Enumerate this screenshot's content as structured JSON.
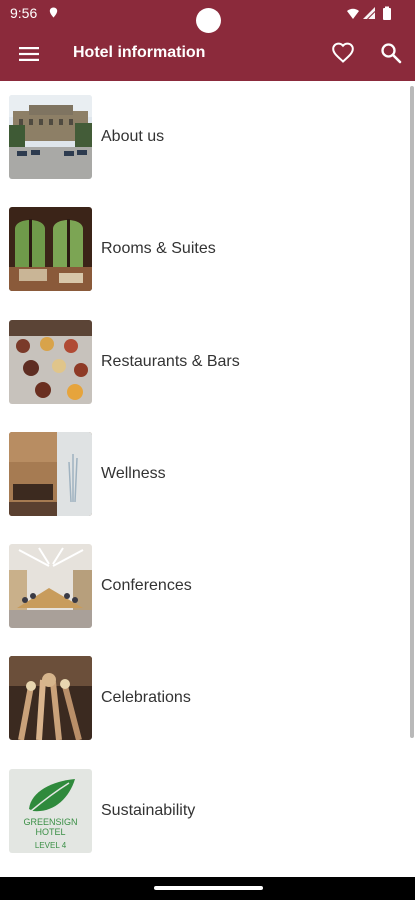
{
  "status_bar": {
    "time": "9:56"
  },
  "app_bar": {
    "title": "Hotel information",
    "colors": {
      "primary": "#8b2a3b",
      "on_primary": "#ffffff"
    },
    "icons": [
      "menu-icon",
      "heart-icon",
      "search-icon"
    ]
  },
  "menu": {
    "items": [
      {
        "label": "About us",
        "image": "hotel-exterior"
      },
      {
        "label": "Rooms & Suites",
        "image": "room-windows"
      },
      {
        "label": "Restaurants & Bars",
        "image": "breakfast-jars"
      },
      {
        "label": "Wellness",
        "image": "spa-lounge"
      },
      {
        "label": "Conferences",
        "image": "conference-room"
      },
      {
        "label": "Celebrations",
        "image": "champagne-toast"
      },
      {
        "label": "Sustainability",
        "image": "greensign-logo"
      }
    ]
  },
  "greensign_logo": {
    "line1": "GREENSIGN",
    "line2": "HOTEL",
    "line3": "LEVEL 4"
  }
}
